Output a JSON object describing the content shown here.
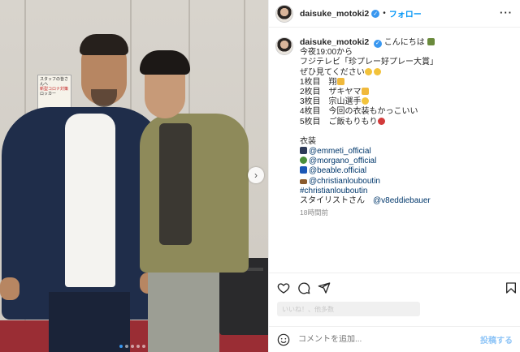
{
  "post": {
    "username": "daisuke_motoki2",
    "follow_label": "フォロー",
    "more_label": "···",
    "caption": {
      "greeting": "こんにちは",
      "lines": [
        "今夜19:00から",
        "フジテレビ「珍プレー好プレー大賞」",
        "ぜひ見てください",
        "1枚目　翔",
        "2枚目　ザキヤマ",
        "3枚目　宗山選手",
        "4枚目　今回の衣装もかっこいい",
        "5枚目　ご飯もりもり"
      ],
      "costume_heading": "衣装",
      "tags": [
        "@emmeti_official",
        "@morgano_official",
        "@beable.official",
        "@christianlouboutin",
        "#christianlouboutin"
      ],
      "stylist_label": "スタイリストさん",
      "stylist_tag": "@v8eddiebauer"
    },
    "time_ago": "18時間前",
    "likes_text": "いいね！、他多数",
    "comment_placeholder": "コメントを追加...",
    "post_button": "投稿する"
  },
  "photo": {
    "sign_lines": [
      "スタッフの皆さんへ",
      "新型コロナ対策",
      "ロッカー"
    ],
    "slide_count": 5,
    "active_slide": 1
  },
  "icons": {
    "next": "chevron-right-icon",
    "like": "heart-icon",
    "comment": "comment-icon",
    "share": "send-icon",
    "save": "bookmark-icon",
    "emoji": "smile-icon",
    "verified": "verified-badge-icon"
  },
  "colors": {
    "follow": "#0095f6",
    "verified": "#3897f0",
    "tag": "#00376b",
    "post_button": "#8fc5f7"
  }
}
